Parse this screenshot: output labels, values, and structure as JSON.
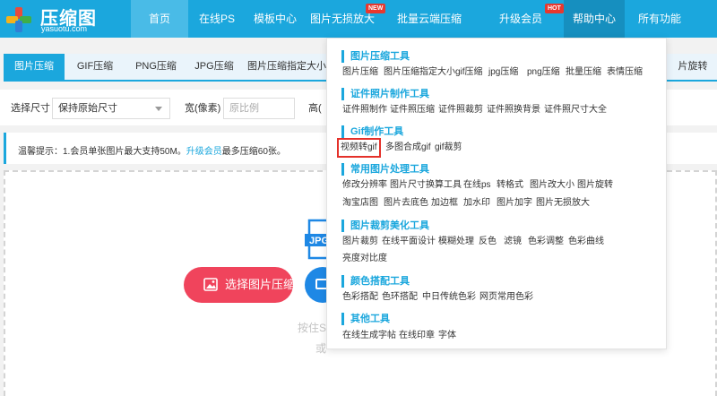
{
  "brand": {
    "name": "压缩图",
    "domain": "yasuotu.com"
  },
  "nav": {
    "items": [
      {
        "label": "首页"
      },
      {
        "label": "在线PS"
      },
      {
        "label": "模板中心"
      },
      {
        "label": "图片无损放大",
        "badge": "NEW"
      },
      {
        "label": "批量云端压缩"
      },
      {
        "label": "升级会员",
        "badge": "HOT"
      },
      {
        "label": "帮助中心"
      },
      {
        "label": "所有功能"
      }
    ]
  },
  "tabs": [
    "图片压缩",
    "GIF压缩",
    "PNG压缩",
    "JPG压缩",
    "图片压缩指定大小",
    "片旋转"
  ],
  "options": {
    "size_label": "选择尺寸",
    "size_value": "保持原始尺寸",
    "width_label": "宽(像素)",
    "width_placeholder": "原比例",
    "height_label": "高("
  },
  "notice": {
    "prefix": "温馨提示：1.会员单张图片最大支持50M。",
    "link": "升级会员",
    "suffix": "最多压缩60张。"
  },
  "upload": {
    "file_badge": "JPG",
    "button_label": "选择图片压缩",
    "hint_1": "按住S",
    "hint_2": "或"
  },
  "dropdown": {
    "sections": [
      {
        "title": "图片压缩工具",
        "links": [
          "图片压缩",
          "图片压缩指定大小",
          "gif压缩",
          "jpg压缩",
          "png压缩",
          "批量压缩",
          "表情压缩"
        ]
      },
      {
        "title": "证件照片制作工具",
        "links": [
          "证件照制作",
          "证件照压缩",
          "证件照裁剪",
          "证件照换背景",
          "证件照尺寸大全"
        ]
      },
      {
        "title": "Gif制作工具",
        "links": [
          "视频转gif",
          "多图合成gif",
          "gif裁剪"
        ],
        "highlighted": "视频转gif"
      },
      {
        "title": "常用图片处理工具",
        "links": [
          "修改分辨率",
          "图片尺寸换算工具",
          "在线ps",
          "转格式",
          "图片改大小",
          "图片旋转",
          "淘宝店图",
          "图片去底色",
          "加边框",
          "加水印",
          "图片加字",
          "图片无损放大"
        ]
      },
      {
        "title": "图片裁剪美化工具",
        "links": [
          "图片裁剪",
          "在线平面设计",
          "模糊处理",
          "反色",
          "滤镜",
          "色彩调整",
          "色彩曲线",
          "亮度对比度"
        ]
      },
      {
        "title": "颜色搭配工具",
        "links": [
          "色彩搭配",
          "色环搭配",
          "中日传统色彩",
          "网页常用色彩"
        ]
      },
      {
        "title": "其他工具",
        "links": [
          "在线生成字帖",
          "在线印章",
          "字体"
        ]
      }
    ]
  },
  "colors": {
    "primary": "#1ba7dd",
    "accent_red": "#f0445c",
    "highlight": "#e4312a"
  }
}
